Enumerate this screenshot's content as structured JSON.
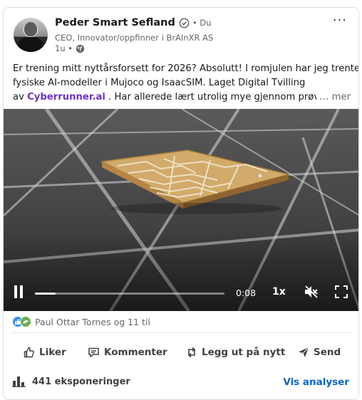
{
  "post": {
    "author_name": "Peder Smart Sefland",
    "degree": "• Du",
    "headline": "CEO, Innovator/oppfinner i BrAInXR AS",
    "timestamp": "1u •",
    "text_line1": "Er trening mitt nyttårsforsett for 2026? Absolutt! I romjulen har jeg trente",
    "text_line2": "fysiske AI-modeller i Mujoco og IsaacSIM. Laget Digital Tvilling",
    "text_line3_prefix": "av ",
    "mention": "Cyberrunner.ai",
    "text_line3_suffix": " . Har allerede lært utrolig mye gjennom prøving",
    "see_more": "… mer"
  },
  "video": {
    "time": "0:08",
    "speed": "1x",
    "progress": 0.11
  },
  "reactions": {
    "summary": "Paul Ottar Tornes og 11 til"
  },
  "actions": {
    "like": "Liker",
    "comment": "Kommenter",
    "repost": "Legg ut på nytt",
    "send": "Send"
  },
  "analytics": {
    "impressions": "441 eksponeringer",
    "link": "Vis analyser"
  },
  "icons": {
    "verified": "verified-icon",
    "globe": "globe-icon",
    "more": "more-options-icon"
  },
  "colors": {
    "mention": "#6f33c2",
    "link": "#0a66c2",
    "text_secondary": "#666666",
    "like_reaction": "#378fe9",
    "support_reaction": "#6dae4f"
  }
}
